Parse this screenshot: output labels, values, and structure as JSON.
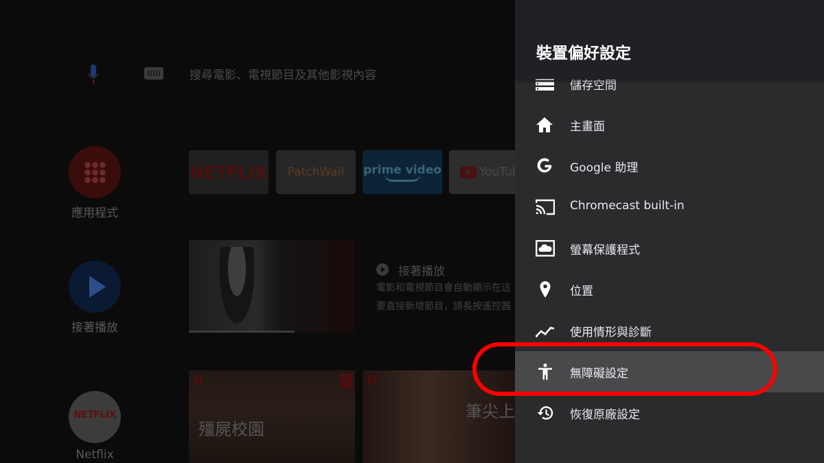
{
  "home": {
    "search_placeholder": "搜尋電影、電視節目及其他影視內容",
    "sidebar": [
      {
        "label": "應用程式",
        "icon": "apps-grid-icon"
      },
      {
        "label": "接著播放",
        "icon": "play-icon"
      },
      {
        "label": "Netflix",
        "icon": "netflix-logo",
        "logo_text": "NETFLIX"
      }
    ],
    "app_tiles": [
      {
        "label": "NETFLIX"
      },
      {
        "label": "PatchWall"
      },
      {
        "label": "prime video"
      },
      {
        "label": "YouTube"
      }
    ],
    "continue_watching": {
      "title": "接著播放",
      "desc_line1": "電影和電視節目會自動顯示在這",
      "desc_line2": "要直接新增節目，請長按遙控器"
    },
    "posters": [
      {
        "badge": "N",
        "top10": "TOP 10",
        "title": "殭屍校園"
      },
      {
        "badge": "N",
        "title": "筆尖上"
      }
    ]
  },
  "settings": {
    "title": "裝置偏好設定",
    "items": [
      {
        "label": "儲存空間",
        "icon": "storage-icon"
      },
      {
        "label": "主畫面",
        "icon": "home-icon"
      },
      {
        "label": "Google 助理",
        "icon": "google-icon"
      },
      {
        "label": "Chromecast built-in",
        "icon": "cast-icon"
      },
      {
        "label": "螢幕保護程式",
        "icon": "screensaver-icon"
      },
      {
        "label": "位置",
        "icon": "location-pin-icon"
      },
      {
        "label": "使用情形與診斷",
        "icon": "analytics-icon"
      },
      {
        "label": "無障礙設定",
        "icon": "accessibility-icon",
        "focused": true
      },
      {
        "label": "恢復原廠設定",
        "icon": "restore-icon"
      }
    ]
  },
  "colors": {
    "panel_bg": "#2a2b2d",
    "header_bg": "#202124",
    "focus_bg": "#48494b",
    "annotation": "#ff0000"
  }
}
